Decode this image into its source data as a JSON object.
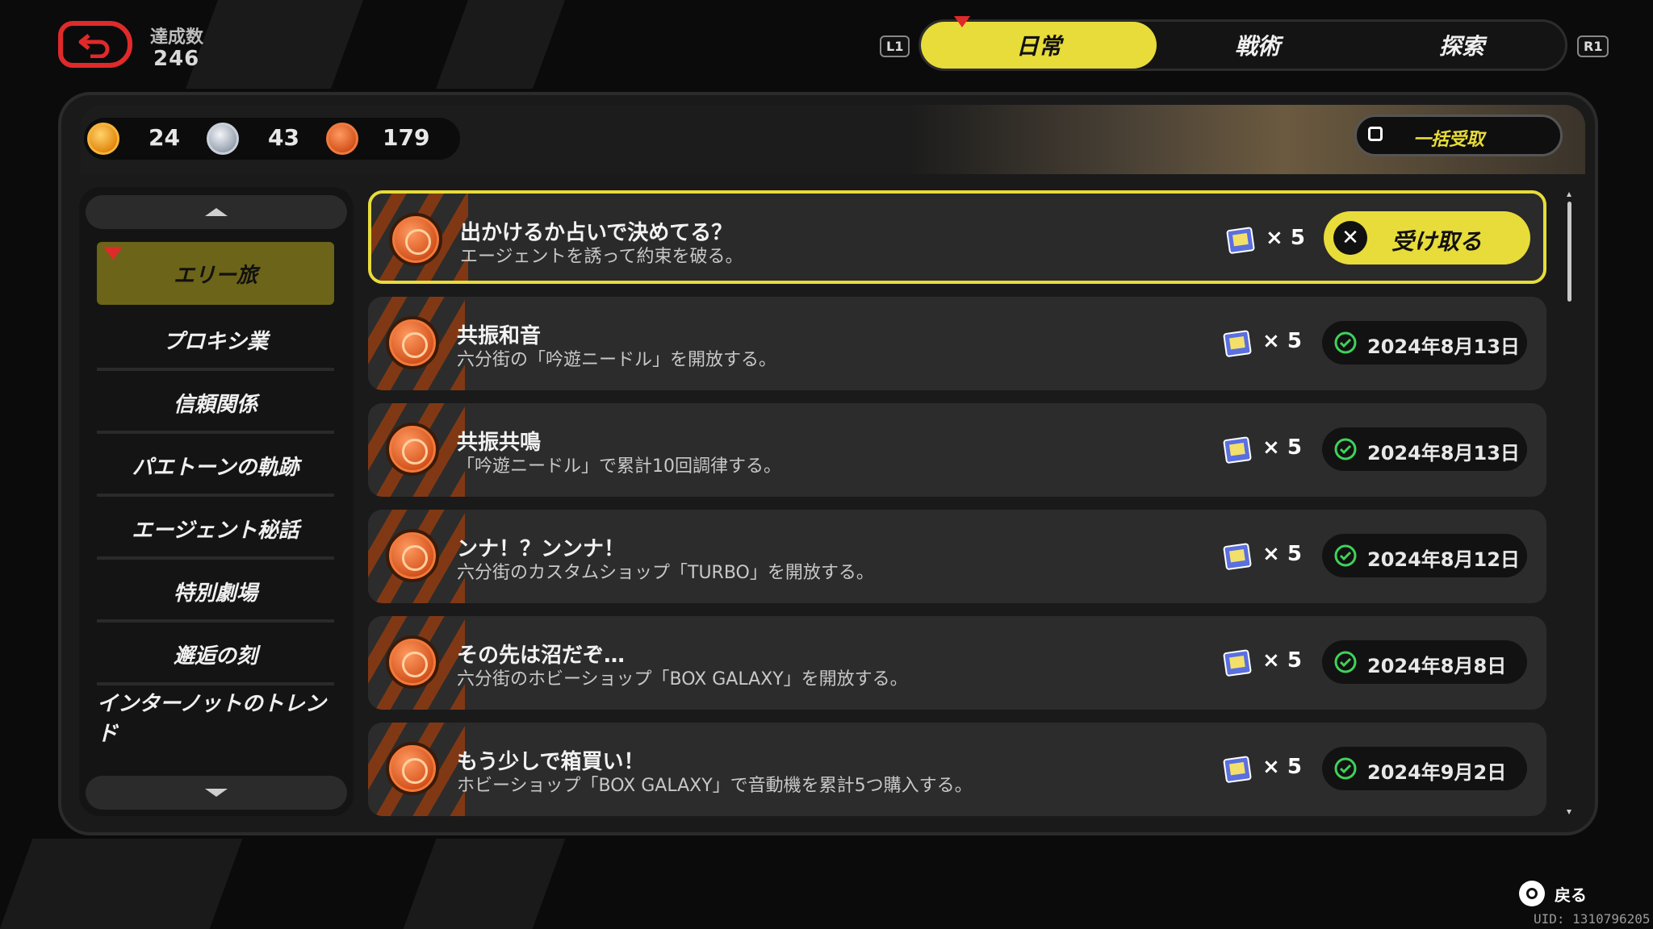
{
  "header": {
    "achievement_label": "達成数",
    "achievement_count": "246"
  },
  "tabs": {
    "l1": "L1",
    "r1": "R1",
    "items": [
      {
        "label": "日常",
        "active": true
      },
      {
        "label": "戦術",
        "active": false
      },
      {
        "label": "探索",
        "active": false
      }
    ]
  },
  "currencies": {
    "gold": "24",
    "silver": "43",
    "bronze": "179"
  },
  "bulk_claim_label": "一括受取",
  "sidebar": {
    "items": [
      {
        "label": "エリー旅",
        "active": true
      },
      {
        "label": "プロキシ業",
        "active": false
      },
      {
        "label": "信頼関係",
        "active": false
      },
      {
        "label": "パエトーンの軌跡",
        "active": false
      },
      {
        "label": "エージェント秘話",
        "active": false
      },
      {
        "label": "特別劇場",
        "active": false
      },
      {
        "label": "邂逅の刻",
        "active": false
      },
      {
        "label": "インターノットのトレンド",
        "active": false
      }
    ]
  },
  "achievements": [
    {
      "title": "出かけるか占いで決めてる？",
      "desc": "エージェントを誘って約束を破る。",
      "reward_qty": "× 5",
      "status": "claim",
      "claim_label": "受け取る"
    },
    {
      "title": "共振和音",
      "desc": "六分街の「吟遊ニードル」を開放する。",
      "reward_qty": "× 5",
      "status": "done",
      "date": "2024年8月13日"
    },
    {
      "title": "共振共鳴",
      "desc": "「吟遊ニードル」で累計10回調律する。",
      "reward_qty": "× 5",
      "status": "done",
      "date": "2024年8月13日"
    },
    {
      "title": "ンナ！？ンンナ！",
      "desc": "六分街のカスタムショップ「TURBO」を開放する。",
      "reward_qty": "× 5",
      "status": "done",
      "date": "2024年8月12日"
    },
    {
      "title": "その先は沼だぞ…",
      "desc": "六分街のホビーショップ「BOX GALAXY」を開放する。",
      "reward_qty": "× 5",
      "status": "done",
      "date": "2024年8月8日"
    },
    {
      "title": "もう少しで箱買い！",
      "desc": "ホビーショップ「BOX GALAXY」で音動機を累計5つ購入する。",
      "reward_qty": "× 5",
      "status": "done",
      "date": "2024年9月2日"
    }
  ],
  "footer": {
    "back_label": "戻る",
    "uid": "UID: 1310796205"
  },
  "colors": {
    "accent": "#e8dc3a",
    "back_red": "#e02a2a",
    "check_green": "#3fd25a"
  }
}
